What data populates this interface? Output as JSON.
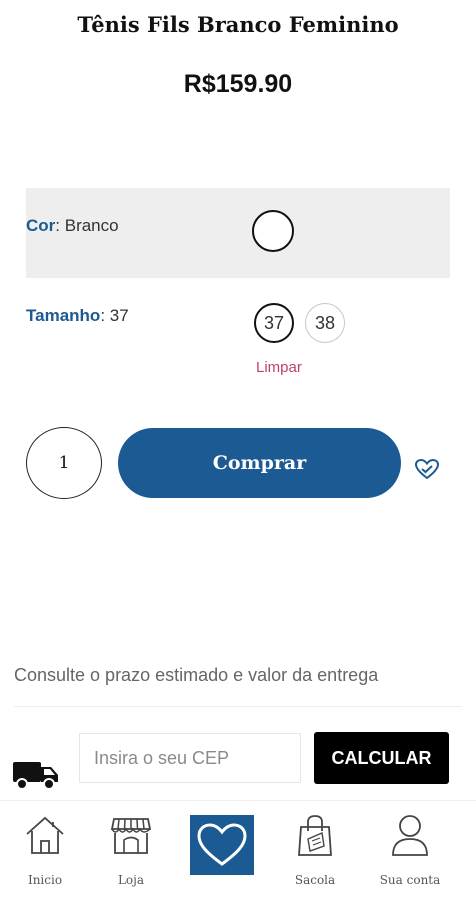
{
  "product": {
    "title": "Tênis Fils Branco Feminino",
    "price": "R$159.90"
  },
  "color": {
    "label": "Cor",
    "value": ": Branco",
    "swatch": "#ffffff"
  },
  "size": {
    "label": "Tamanho",
    "value": ": 37",
    "options": [
      "37",
      "38"
    ],
    "selected": "37",
    "clear_label": "Limpar"
  },
  "purchase": {
    "quantity": "1",
    "buy_label": "Comprar"
  },
  "shipping": {
    "prompt": "Consulte o prazo estimado e valor da entrega",
    "cep_placeholder": "Insira o seu CEP",
    "calc_label": "CALCULAR"
  },
  "nav": {
    "items": [
      "Inicio",
      "Loja",
      "Sacola",
      "Sua conta"
    ]
  },
  "colors": {
    "accent": "#1b5a92",
    "label_blue": "#1c5a91",
    "clear_pink": "#c2416b"
  }
}
